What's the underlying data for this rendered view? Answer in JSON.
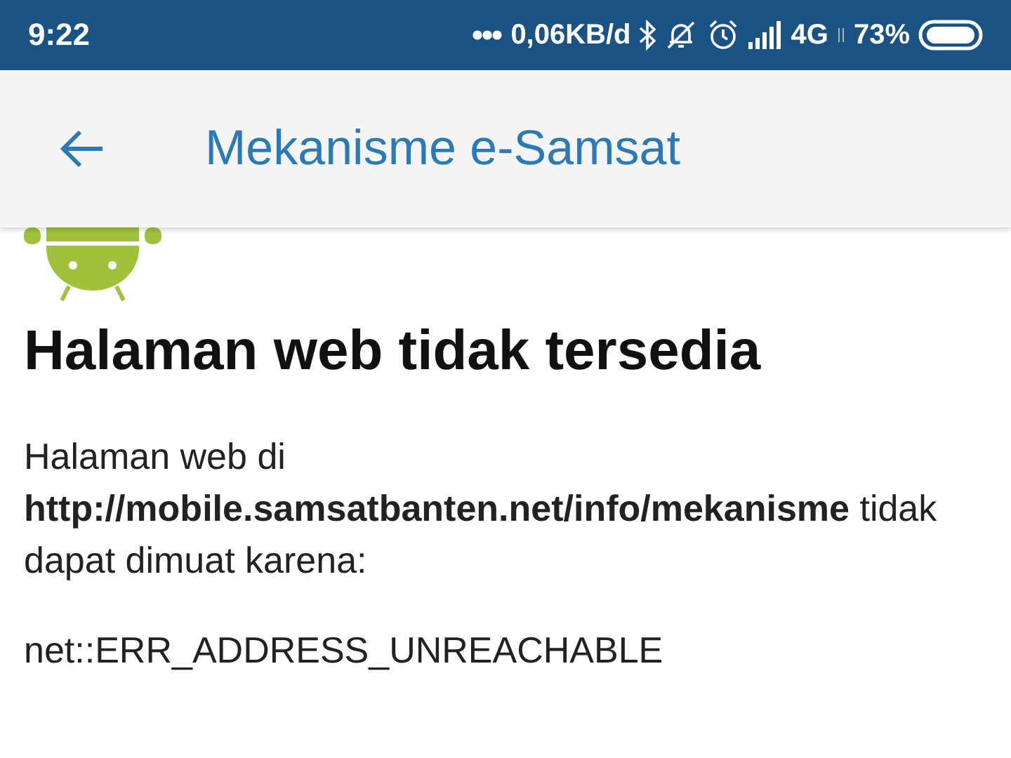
{
  "status_bar": {
    "time": "9:22",
    "data_rate": "0,06KB/d",
    "network": "4G",
    "battery": "73%"
  },
  "app_bar": {
    "title": "Mekanisme e-Samsat"
  },
  "error_page": {
    "heading": "Halaman web tidak tersedia",
    "message": "Halaman web di **http://mobile.samsatbanten.net/info/mekanisme** tidak dapat dimuat karena:",
    "error_code": "net::ERR_ADDRESS_UNREACHABLE"
  }
}
